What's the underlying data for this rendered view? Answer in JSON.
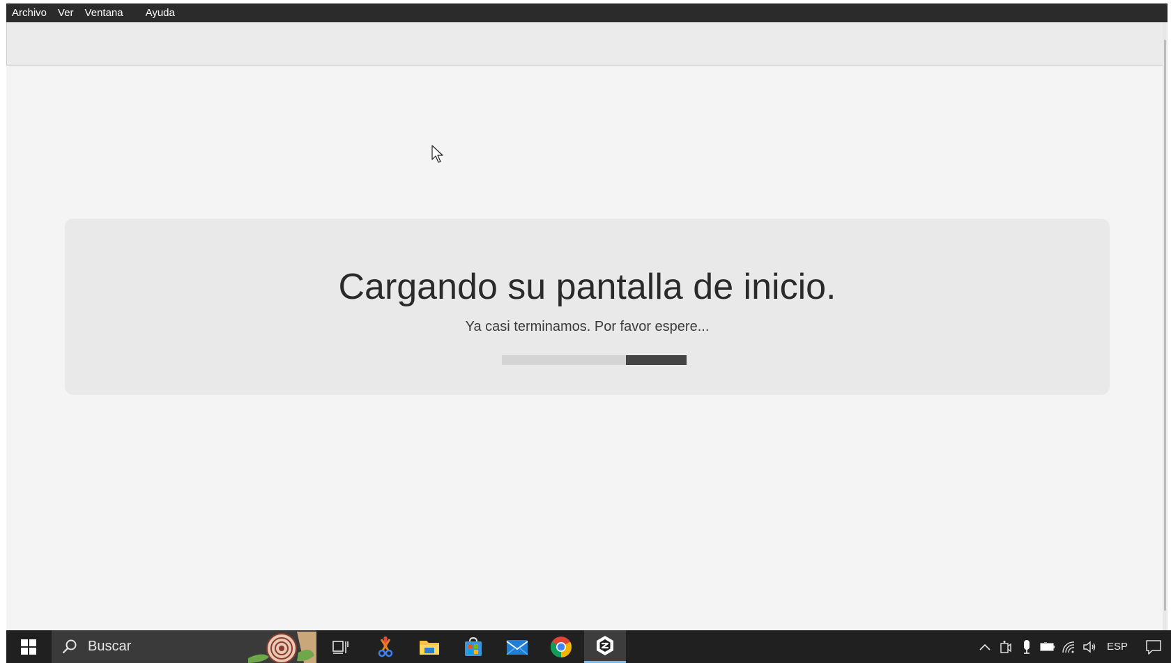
{
  "menu": {
    "items": [
      {
        "label": "Archivo"
      },
      {
        "label": "Ver"
      },
      {
        "label": "Ventana"
      },
      {
        "label": "Ayuda"
      }
    ]
  },
  "loading": {
    "title": "Cargando su pantalla de inicio.",
    "subtitle": "Ya casi terminamos. Por favor espere...",
    "progress_percent": 33
  },
  "taskbar": {
    "search_placeholder": "Buscar",
    "apps": [
      {
        "icon": "task-view-icon"
      },
      {
        "icon": "snipping-tool-icon"
      },
      {
        "icon": "file-explorer-icon"
      },
      {
        "icon": "microsoft-store-icon"
      },
      {
        "icon": "mail-icon"
      },
      {
        "icon": "chrome-icon"
      },
      {
        "icon": "app-hexagon-icon",
        "active": true
      }
    ],
    "tray": {
      "language": "ESP",
      "icons": [
        "chevron-up-icon",
        "meet-now-icon",
        "microphone-icon",
        "battery-icon",
        "wifi-icon",
        "volume-icon"
      ]
    }
  },
  "colors": {
    "menubar_bg": "#2b2b2b",
    "content_bg": "#f4f4f4",
    "card_bg": "#e9e9e9",
    "progress_track": "#d4d4d4",
    "progress_fill": "#444444",
    "taskbar_bg": "#202020"
  }
}
